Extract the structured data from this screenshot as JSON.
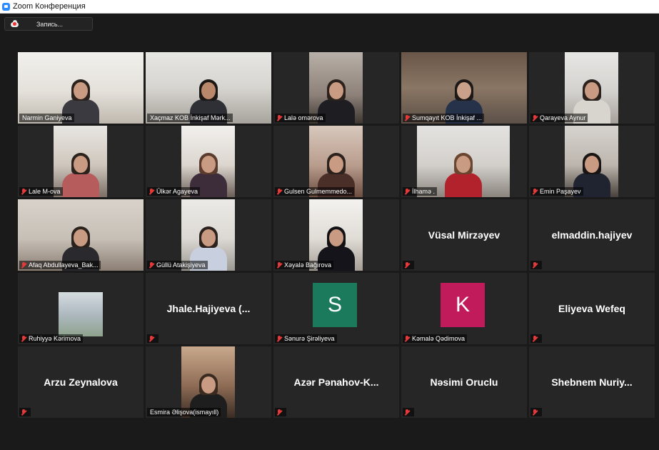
{
  "window": {
    "title": "Zoom Конференция"
  },
  "toolbar": {
    "record_label": "Запись..."
  },
  "colors": {
    "active_speaker_border": "#e8e86a",
    "muted_mic": "#e5393a",
    "avatar_s": "#1c7a5c",
    "avatar_k": "#c11b5b"
  },
  "participants": [
    {
      "name": "Narmin Ganiyeva"
    },
    {
      "name": "Xaçmaz KOB İnkişaf Mərk..."
    },
    {
      "name": "Lalə omərova"
    },
    {
      "name": "Sumqayıt KOB İnkişaf ..."
    },
    {
      "name": "Qarayeva Aynur"
    },
    {
      "name": "Lale M-ova"
    },
    {
      "name": "Ülkər Agayeva"
    },
    {
      "name": "Gulsen Gulmemmedo..."
    },
    {
      "name": "İlhamə ."
    },
    {
      "name": "Emin Paşayev"
    },
    {
      "name": "Afaq Abdullayeva_Bak..."
    },
    {
      "name": "Güllü Atakişiyeva"
    },
    {
      "name": "Xəyalə Bağırova"
    },
    {
      "name": "Vüsal Mirzəyev"
    },
    {
      "name": "elmaddin.hajiyev"
    },
    {
      "name": "Ruhiyyə Kərimova"
    },
    {
      "name": "Jhale.Hajiyeva (..."
    },
    {
      "name": "Sənurə Şirəliyeva",
      "initial": "S"
    },
    {
      "name": "Kəmalə Qədimova",
      "initial": "K"
    },
    {
      "name": "Eliyeva Wefeq"
    },
    {
      "name": "Arzu Zeynalova"
    },
    {
      "name": "Esmira Əlişova(ismayıll)"
    },
    {
      "name": "Azər Pənahov-K..."
    },
    {
      "name": "Nəsimi Oruclu"
    },
    {
      "name": "Shebnem Nuriy..."
    }
  ]
}
